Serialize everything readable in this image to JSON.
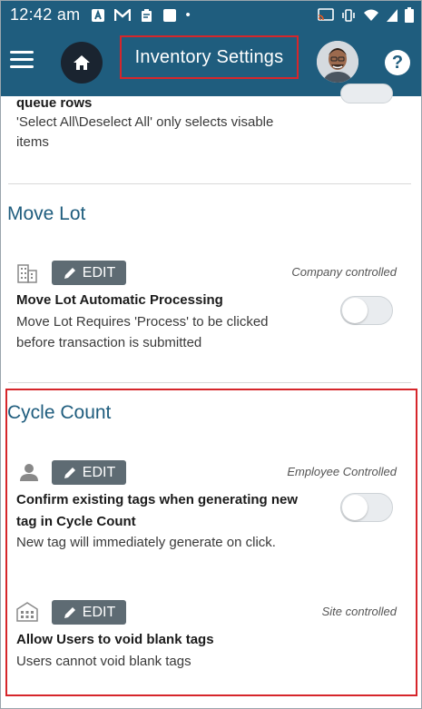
{
  "status_bar": {
    "time": "12:42 am",
    "battery_glyph": "▮"
  },
  "header": {
    "title": "Inventory Settings"
  },
  "top_setting": {
    "title": "queue rows",
    "description_line1": "'Select All\\Deselect All' only selects visable",
    "description_line2": "items"
  },
  "sections": {
    "move_lot": {
      "title": "Move Lot",
      "edit_label": "EDIT",
      "control": "Company controlled",
      "setting_title": "Move Lot Automatic Processing",
      "desc_line1": "Move Lot Requires 'Process' to be clicked",
      "desc_line2": "before transaction is submitted"
    },
    "cycle_count": {
      "title": "Cycle Count",
      "item1": {
        "edit_label": "EDIT",
        "control": "Employee Controlled",
        "title_line1": "Confirm existing tags when generating new",
        "title_line2": "tag in Cycle Count",
        "desc": "New tag will immediately generate on click."
      },
      "item2": {
        "edit_label": "EDIT",
        "control": "Site controlled",
        "title": "Allow Users to void blank tags",
        "desc": "Users cannot void blank tags"
      }
    }
  },
  "colors": {
    "header_bg": "#1f5d7e",
    "highlight": "#d6262b",
    "edit_bg": "#5e6b73"
  }
}
